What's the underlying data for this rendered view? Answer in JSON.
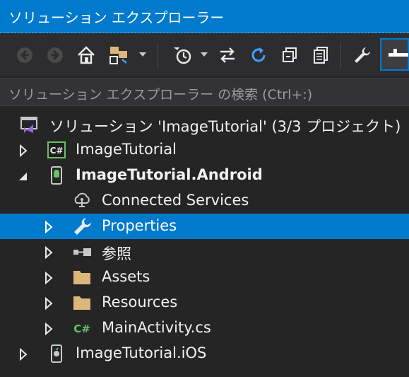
{
  "window": {
    "title": "ソリューション エクスプローラー"
  },
  "toolbar": {
    "buttons": [
      {
        "name": "back-icon"
      },
      {
        "name": "forward-icon"
      },
      {
        "name": "home-icon"
      },
      {
        "name": "switch-views-icon"
      },
      {
        "name": "pending-changes-filter-icon"
      },
      {
        "name": "sync-active-document-icon"
      },
      {
        "name": "refresh-icon"
      },
      {
        "name": "collapse-all-icon"
      },
      {
        "name": "show-all-files-icon"
      },
      {
        "name": "properties-wrench-icon"
      },
      {
        "name": "preview-selected-icon"
      }
    ]
  },
  "search": {
    "placeholder": "ソリューション エクスプローラー の検索 (Ctrl+:)"
  },
  "tree": {
    "solution": {
      "label": "ソリューション 'ImageTutorial' (3/3 プロジェクト)",
      "icon": "solution-icon"
    },
    "items": [
      {
        "label": "ImageTutorial",
        "icon": "csharp-project-icon",
        "expanded": false,
        "bold": false
      },
      {
        "label": "ImageTutorial.Android",
        "icon": "android-project-icon",
        "expanded": true,
        "bold": true
      },
      {
        "label": "Connected Services",
        "icon": "connected-services-icon"
      },
      {
        "label": "Properties",
        "icon": "wrench-icon",
        "expanded": false,
        "selected": true
      },
      {
        "label": "参照",
        "icon": "references-icon",
        "expanded": false
      },
      {
        "label": "Assets",
        "icon": "folder-icon",
        "expanded": false
      },
      {
        "label": "Resources",
        "icon": "folder-icon",
        "expanded": false
      },
      {
        "label": "MainActivity.cs",
        "icon": "csharp-file-icon",
        "expanded": false
      },
      {
        "label": "ImageTutorial.iOS",
        "icon": "ios-project-icon",
        "expanded": false,
        "bold": false
      }
    ]
  },
  "colors": {
    "accent": "#007acc",
    "background": "#252526",
    "folder": "#dcb67a",
    "csharp": "#68c16a",
    "solution": "#9b66d6"
  }
}
